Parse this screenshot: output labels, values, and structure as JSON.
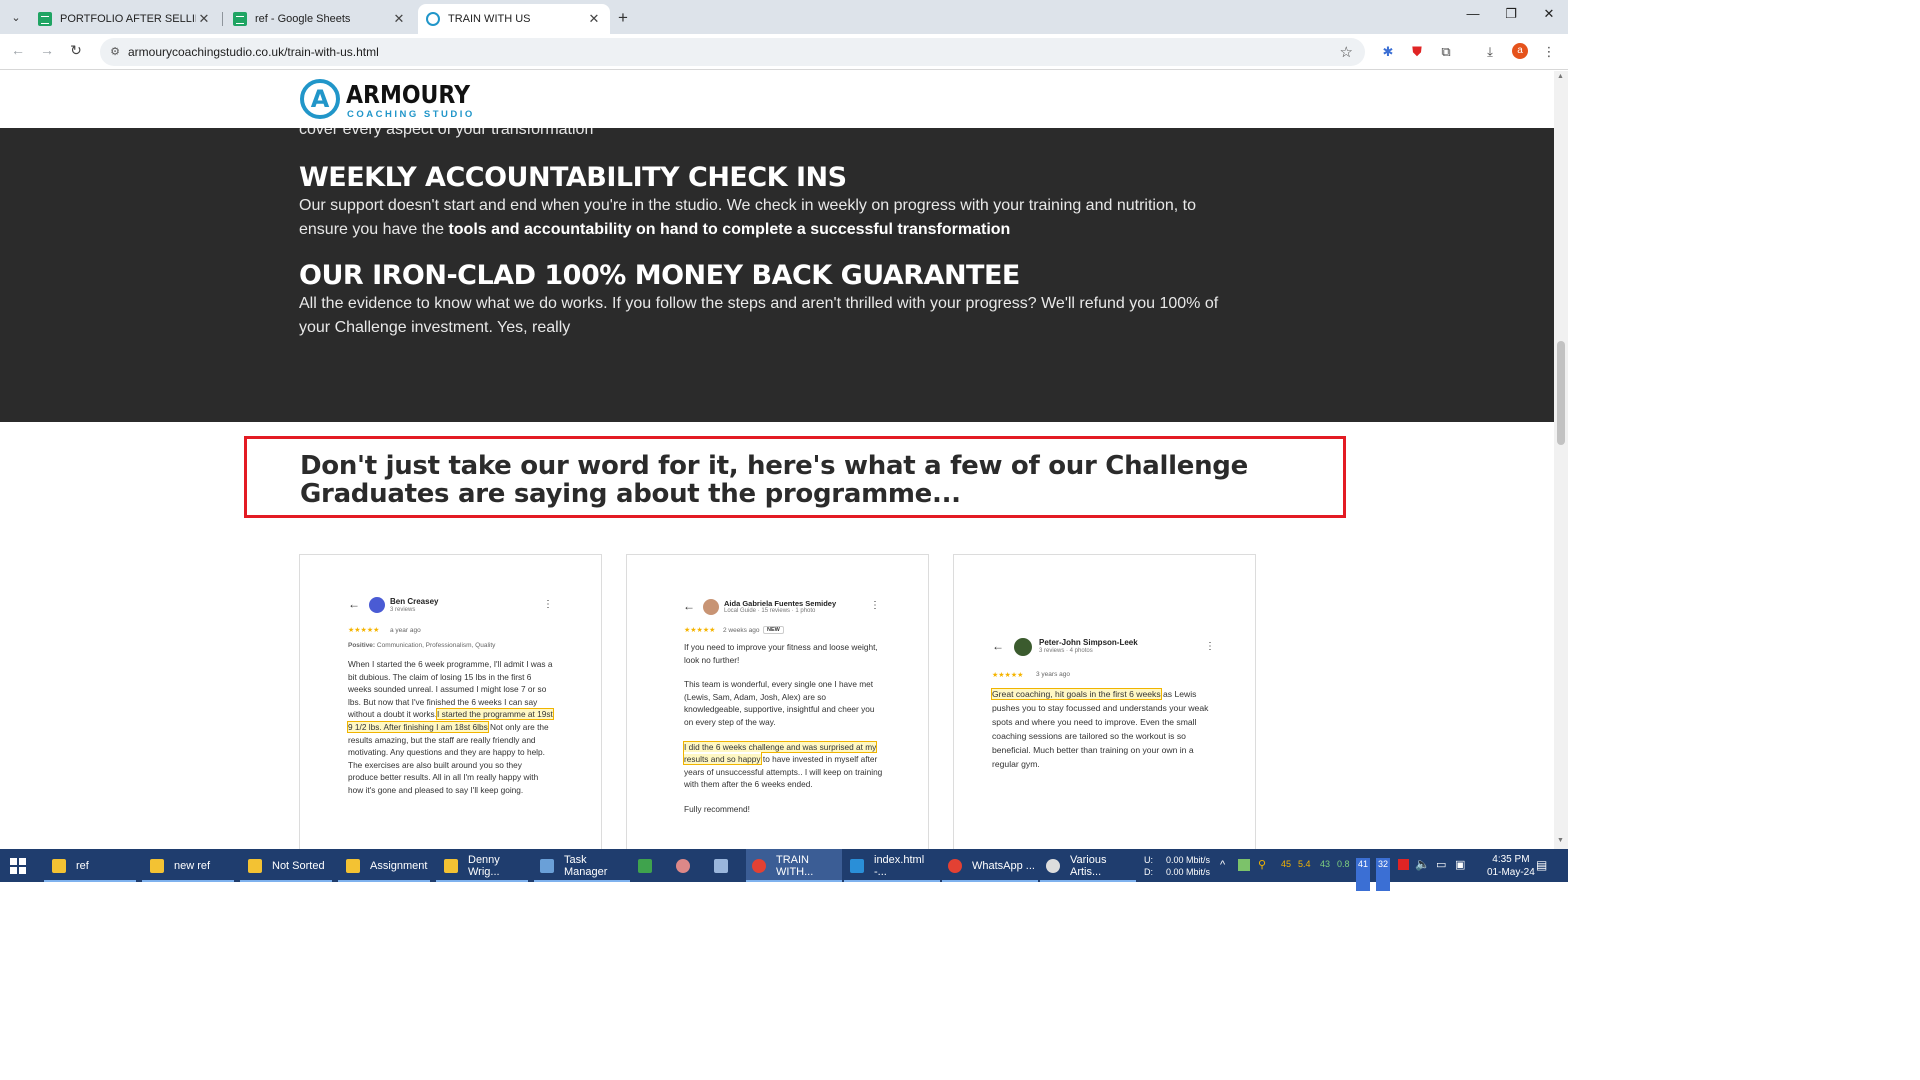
{
  "browser": {
    "tabs": [
      {
        "title": "PORTFOLIO AFTER SELLING - G",
        "icon": "sheets-icon"
      },
      {
        "title": "ref - Google Sheets",
        "icon": "sheets-icon"
      },
      {
        "title": "TRAIN WITH US",
        "icon": "armoury-icon"
      }
    ],
    "new_tab": "+",
    "url": "armourycoachingstudio.co.uk/train-with-us.html",
    "profile_initial": "a"
  },
  "site": {
    "logo_mark": "A",
    "logo_name": "ARMOURY",
    "logo_sub": "COACHING STUDIO"
  },
  "dark": {
    "cut_text": "cover every aspect of your transformation",
    "h1": "WEEKLY ACCOUNTABILITY CHECK INS",
    "p1_a": "Our support doesn't start and end when you're in the studio. We check in weekly on progress with your training and nutrition, to ensure you have the ",
    "p1_b": "tools and accountability on hand to complete a successful transformation",
    "h2": "OUR IRON-CLAD 100% MONEY BACK GUARANTEE",
    "p2": "All the evidence to know what we do works. If you follow the steps and aren't thrilled with your progress? We'll refund you 100% of your Challenge investment. Yes, really"
  },
  "testimonials": {
    "heading": "Don't just take our word for it, here's what a few of our Challenge Graduates are saying about the programme...",
    "reviews": [
      {
        "name": "Ben Creasey",
        "meta": "3 reviews",
        "stars": "★★★★★",
        "ago": "a year ago",
        "positive_label": "Positive:",
        "positive": "Communication, Professionalism, Quality",
        "body_a": "When I started the 6 week programme, I'll admit I was a bit dubious. The claim of losing 15 lbs in the first 6 weeks sounded unreal. I assumed I might lose 7 or so lbs. But now that I've finished the 6 weeks I can say without a doubt it works.",
        "body_hl": "I started the programme at 19st 9 1/2 lbs. After finishing I am 18st 6lbs",
        "body_b": " Not only are the results amazing, but the staff are really friendly and motivating. Any questions and they are happy to help. The exercises are also built around you so they produce better results. All in all I'm really happy with how it's gone and pleased to say I'll keep going."
      },
      {
        "name": "Aida Gabriela Fuentes Semidey",
        "meta": "Local Guide · 15 reviews · 1 photo",
        "stars": "★★★★★",
        "ago": "2 weeks ago",
        "badge": "NEW",
        "p1": "If you need to improve your fitness and loose weight, look no further!",
        "p2": "This team is wonderful, every single one I have met (Lewis, Sam, Adam, Josh, Alex) are so knowledgeable, supportive, insightful and cheer you on every step of the way.",
        "body_hl": "I did the 6 weeks challenge and was surprised at my results and so happy",
        "body_b": " to have invested in myself after years of unsuccessful attempts.. I will keep on training with them after the 6 weeks ended.",
        "p4": "Fully recommend!"
      },
      {
        "name": "Peter-John Simpson-Leek",
        "meta": "3 reviews · 4 photos",
        "stars": "★★★★★",
        "ago": "3 years ago",
        "body_hl": "Great coaching, hit goals in the first 6 weeks",
        "body_b": " as Lewis pushes you to stay focussed and understands your weak spots and where you need to improve. Even the small coaching sessions are tailored so the workout is so beneficial. Much better than training on your own in a regular gym."
      }
    ]
  },
  "taskbar": {
    "items": [
      {
        "label": "ref"
      },
      {
        "label": "new ref"
      },
      {
        "label": "Not Sorted"
      },
      {
        "label": "Assignment"
      },
      {
        "label": "Denny Wrig..."
      },
      {
        "label": "Task Manager"
      },
      {
        "label": "TRAIN WITH..."
      },
      {
        "label": "index.html -..."
      },
      {
        "label": "WhatsApp ..."
      },
      {
        "label": "Various Artis..."
      }
    ],
    "net_u_label": "U:",
    "net_d_label": "D:",
    "net_up": "0.00 Mbit/s",
    "net_down": "0.00 Mbit/s",
    "tray_nums": [
      "45",
      "5.4",
      "43",
      "0.8"
    ],
    "badge_a": "41",
    "badge_b": "32",
    "time": "4:35 PM",
    "date": "01-May-24"
  }
}
